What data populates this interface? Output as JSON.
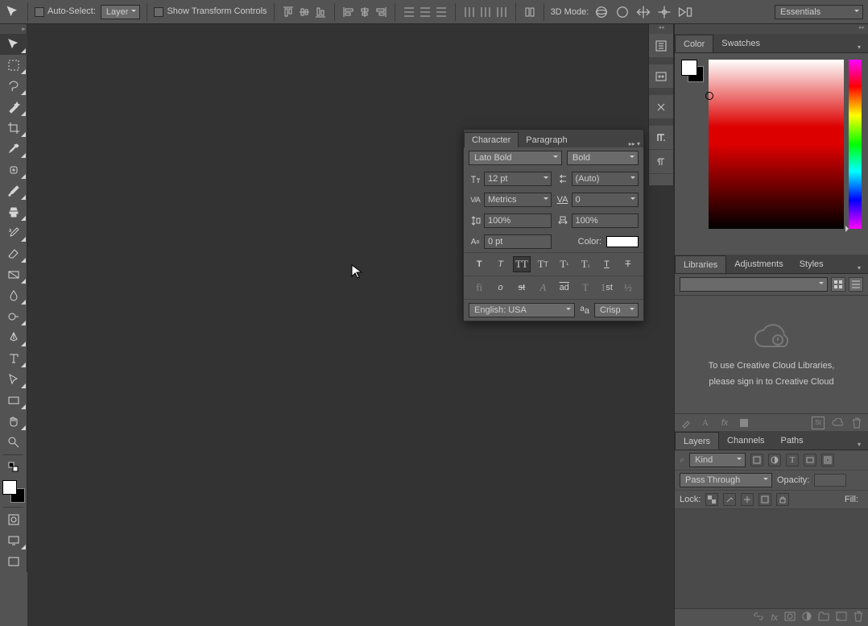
{
  "options_bar": {
    "auto_select_label": "Auto-Select:",
    "auto_select_target": "Layer",
    "show_transform_label": "Show Transform Controls",
    "mode3d_label": "3D Mode:",
    "workspace": "Essentials"
  },
  "character_panel": {
    "tab_character": "Character",
    "tab_paragraph": "Paragraph",
    "font_family": "Lato Bold",
    "font_style": "Bold",
    "font_size": "12 pt",
    "leading": "(Auto)",
    "kerning": "Metrics",
    "tracking": "0",
    "vscale": "100%",
    "hscale": "100%",
    "baseline_shift": "0 pt",
    "color_label": "Color:",
    "language": "English: USA",
    "anti_alias": "Crisp"
  },
  "right_panels": {
    "color_tab": "Color",
    "swatches_tab": "Swatches",
    "libraries_tab": "Libraries",
    "adjustments_tab": "Adjustments",
    "styles_tab": "Styles",
    "libraries_msg_line1": "To use Creative Cloud Libraries,",
    "libraries_msg_line2": "please sign in to Creative Cloud",
    "layers_tab": "Layers",
    "channels_tab": "Channels",
    "paths_tab": "Paths",
    "layers_filter": "Kind",
    "blend_mode": "Pass Through",
    "opacity_label": "Opacity:",
    "lock_label": "Lock:",
    "fill_label": "Fill:"
  }
}
